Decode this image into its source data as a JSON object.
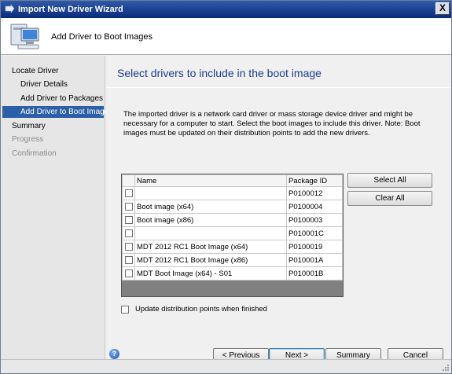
{
  "window": {
    "title": "Import New Driver Wizard",
    "close_label": "X"
  },
  "header": {
    "title": "Add Driver to Boot Images"
  },
  "sidebar": {
    "items": [
      {
        "label": "Locate Driver",
        "state": "normal"
      },
      {
        "label": "Driver Details",
        "state": "normal"
      },
      {
        "label": "Add Driver to Packages",
        "state": "normal"
      },
      {
        "label": "Add Driver to Boot Images",
        "state": "selected"
      },
      {
        "label": "Summary",
        "state": "normal"
      },
      {
        "label": "Progress",
        "state": "disabled"
      },
      {
        "label": "Confirmation",
        "state": "disabled"
      }
    ]
  },
  "main": {
    "heading": "Select drivers to include in the boot image",
    "description": "The imported driver is a network card driver or mass storage device driver and might be necessary for a computer to start. Select the boot images to include this driver.  Note: Boot images must be updated on their distribution points to add the new drivers.",
    "grid": {
      "columns": [
        "Name",
        "Package ID"
      ],
      "rows": [
        {
          "name": "",
          "package_id": "P0100012",
          "checked": false
        },
        {
          "name": "Boot image (x64)",
          "package_id": "P0100004",
          "checked": false
        },
        {
          "name": "Boot image (x86)",
          "package_id": "P0100003",
          "checked": false
        },
        {
          "name": "",
          "package_id": "P010001C",
          "checked": false
        },
        {
          "name": "MDT 2012 RC1 Boot Image (x64)",
          "package_id": "P0100019",
          "checked": false
        },
        {
          "name": "MDT 2012 RC1 Boot Image (x86)",
          "package_id": "P010001A",
          "checked": false
        },
        {
          "name": "MDT Boot Image (x64) - S01",
          "package_id": "P010001B",
          "checked": false
        }
      ]
    },
    "select_all_label": "Select All",
    "clear_all_label": "Clear All",
    "update_dp_label": "Update distribution points when finished"
  },
  "footer": {
    "help_label": "?",
    "previous_label": "< Previous",
    "next_label": "Next >",
    "summary_label": "Summary",
    "cancel_label": "Cancel"
  },
  "colors": {
    "accent": "#2d5ea8",
    "heading": "#1c3c8c",
    "title_bar": "#0a2a7a"
  },
  "icons": {
    "title": "wizard-arrow-icon",
    "header": "computer-icon",
    "help": "help-icon"
  }
}
